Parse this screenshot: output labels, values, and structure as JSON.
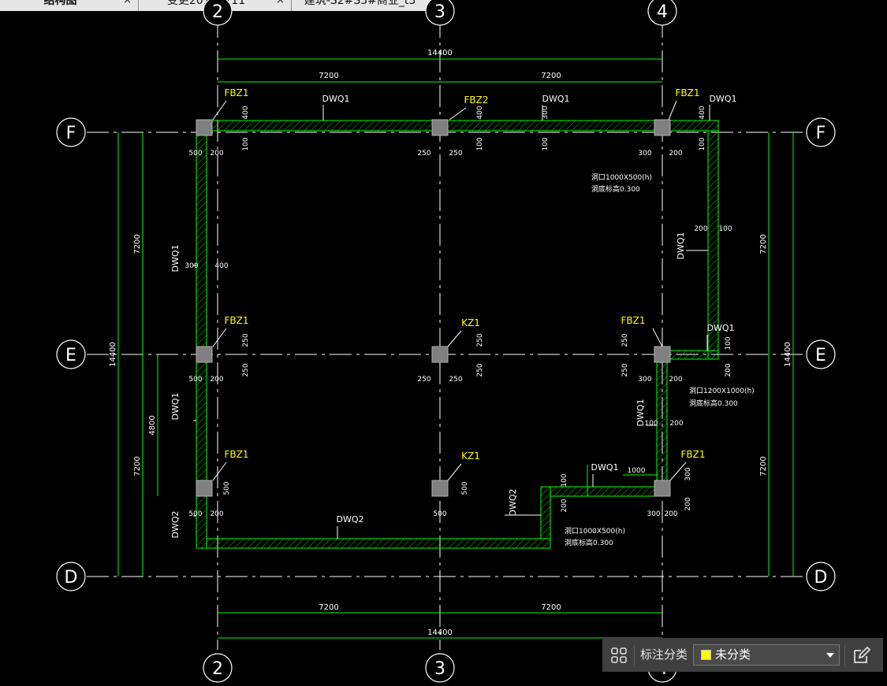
{
  "tabs": [
    {
      "label": "结构图",
      "close": "×",
      "active": true
    },
    {
      "label": "变更20191211",
      "close": "×",
      "active": false
    },
    {
      "label": "建筑-S2#S3#商业_t3",
      "close": "×",
      "active": false
    }
  ],
  "axes": {
    "col_2": "2",
    "col_3": "3",
    "col_4": "4",
    "row_F": "F",
    "row_E": "E",
    "row_D": "D"
  },
  "dims": {
    "total_x": "14400",
    "bay_x": "7200",
    "total_y": "14400",
    "bay_y": "7200",
    "d4800": "4800",
    "d500": "500",
    "d200": "200",
    "d250": "250",
    "d300": "300",
    "d400": "400",
    "d100": "100",
    "d1000": "1000"
  },
  "labels": {
    "fbz1": "FBZ1",
    "fbz2": "FBZ2",
    "kz1": "KZ1",
    "dwq1": "DWQ1",
    "dwq2": "DWQ2",
    "hole1a": "洞口1000X500(h)",
    "hole1b": "洞底标高0.300",
    "hole2a": "洞口1200X1000(h)",
    "hole2b": "洞底标高0.300",
    "hole3a": "洞口1000X500(h)",
    "hole3b": "洞底标高0.300"
  },
  "colors": {
    "background": "#000000",
    "dim_line": "#00ff00",
    "wall": "#00ff00",
    "axis": "#ffffff",
    "callout": "#ffff00",
    "column": "#808080"
  },
  "panel": {
    "grid_icon": "grid-icon",
    "label": "标注分类",
    "selected": "未分类",
    "swatch_color": "#ffff00",
    "edit_icon": "edit-icon"
  }
}
